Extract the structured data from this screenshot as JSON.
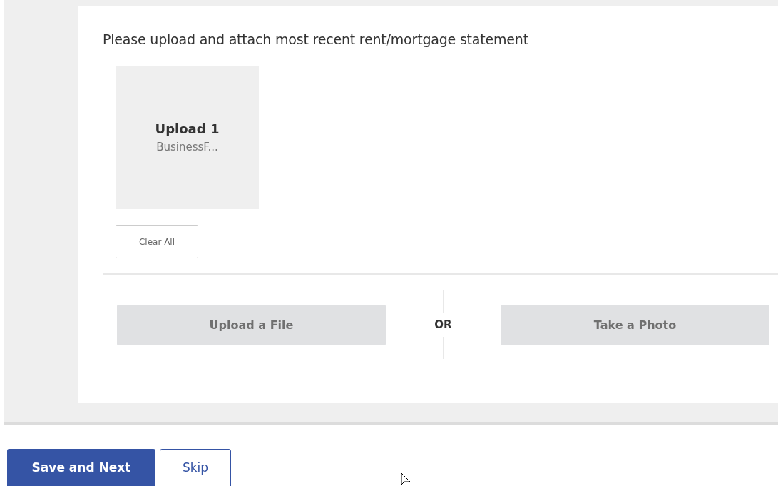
{
  "instruction": "Please upload and attach most recent rent/mortgage statement",
  "uploads": [
    {
      "title": "Upload 1",
      "file_name": "BusinessF..."
    }
  ],
  "clear_button": "Clear All",
  "upload_button": "Upload a File",
  "separator": "OR",
  "photo_button": "Take a Photo",
  "actions": [
    {
      "label": "Save and Next",
      "kind": "primary"
    },
    {
      "label": "Skip",
      "kind": "secondary"
    }
  ]
}
